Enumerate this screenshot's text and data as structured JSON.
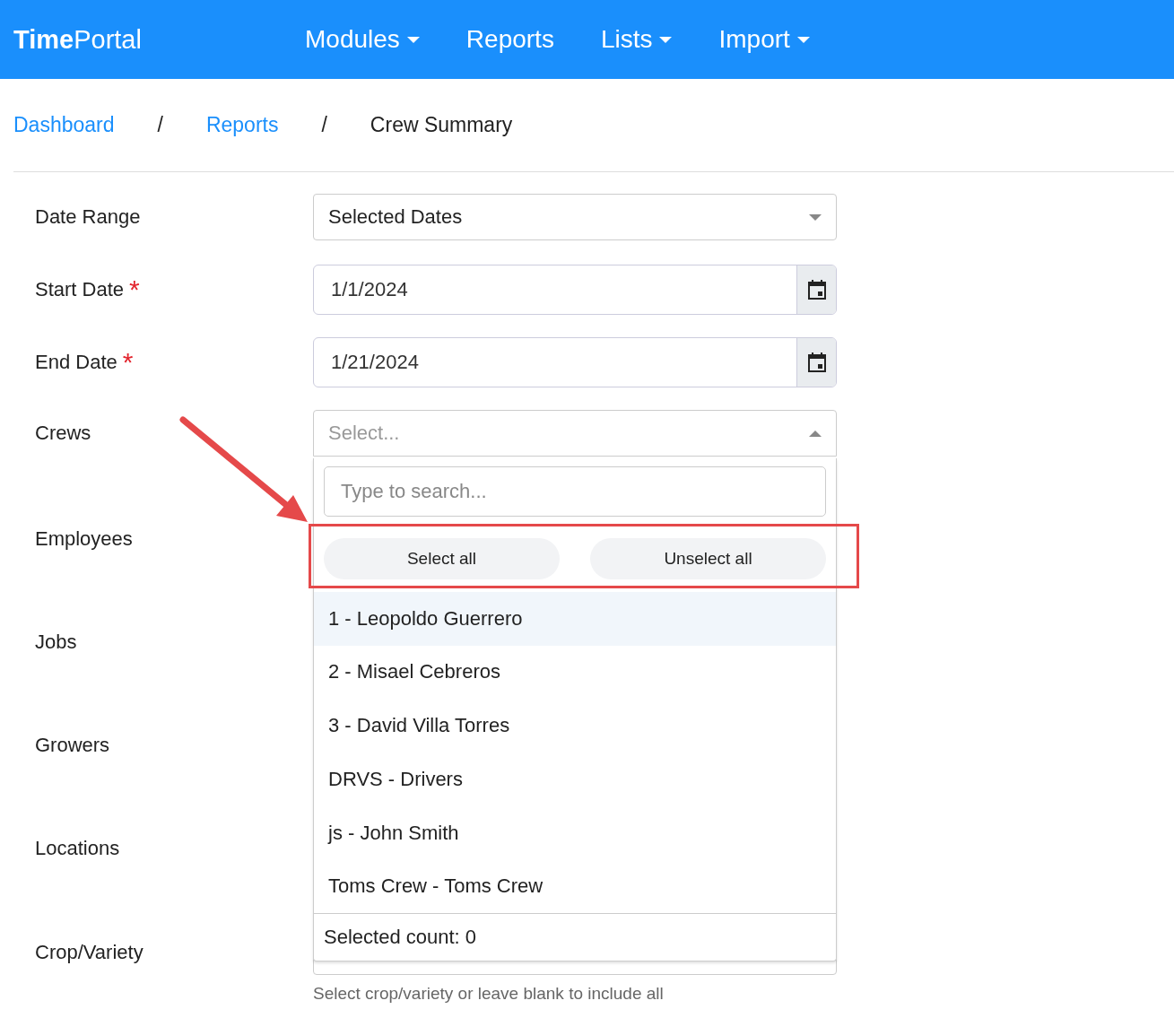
{
  "navbar": {
    "brand": "**Time**Portal",
    "items": [
      {
        "label": "Modules",
        "dropdown": true
      },
      {
        "label": "Reports",
        "dropdown": false
      },
      {
        "label": "Lists",
        "dropdown": true
      },
      {
        "label": "Import",
        "dropdown": true
      }
    ]
  },
  "breadcrumb": [
    {
      "label": "Dashboard",
      "link": true
    },
    {
      "label": "/",
      "link": false
    },
    {
      "label": "Reports",
      "link": true
    },
    {
      "label": "/",
      "link": false
    },
    {
      "label": "Crew Summary",
      "link": false
    }
  ],
  "form": {
    "rows": [
      {
        "label": "Date Range",
        "kind": "select",
        "value": "Selected Dates",
        "required": false
      },
      {
        "label": "Start Date",
        "kind": "date",
        "value": "1/1/2024",
        "required": true
      },
      {
        "label": "End Date",
        "kind": "date",
        "value": "1/21/2024",
        "required": true
      },
      {
        "label": "Crews",
        "kind": "multiselect",
        "placeholder": "Select...",
        "required": false,
        "expanded": true
      },
      {
        "label": "Employees",
        "kind": "hidden",
        "required": false
      },
      {
        "label": "Jobs",
        "kind": "hidden",
        "required": false
      },
      {
        "label": "Growers",
        "kind": "hidden",
        "required": false
      },
      {
        "label": "Locations",
        "kind": "hidden",
        "required": false
      },
      {
        "label": "Crop/Variety",
        "kind": "select",
        "value": "",
        "required": false,
        "hint": "Select crop/variety or leave blank to include all"
      }
    ]
  },
  "required_mark": "*",
  "dropdown": {
    "search_placeholder": "Type to search...",
    "buttons": [
      "Select all",
      "Unselect all"
    ],
    "options": [
      {
        "label": "1 - Leopoldo Guerrero",
        "highlighted": true
      },
      {
        "label": "2 - Misael Cebreros",
        "highlighted": false
      },
      {
        "label": "3 - David Villa Torres",
        "highlighted": false
      },
      {
        "label": "DRVS - Drivers",
        "highlighted": false
      },
      {
        "label": "js - John Smith",
        "highlighted": false
      },
      {
        "label": "Toms Crew - Toms Crew",
        "highlighted": false
      }
    ],
    "footer": "Selected count: 0"
  }
}
